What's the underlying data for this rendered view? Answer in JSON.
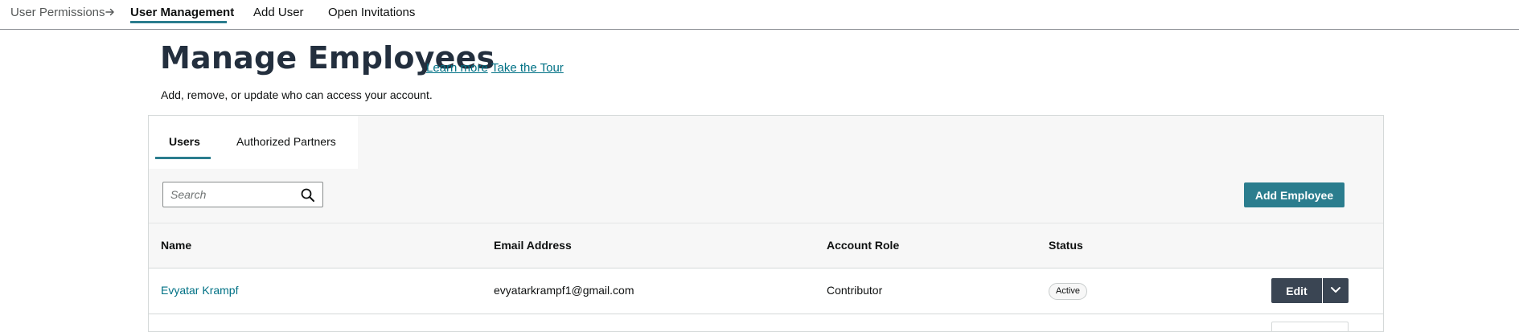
{
  "breadcrumb": {
    "parent": "User Permissions",
    "separator_icon": "arrow-right-icon"
  },
  "nav": {
    "items": [
      {
        "label": "User Management",
        "active": true
      },
      {
        "label": "Add User",
        "active": false
      },
      {
        "label": "Open Invitations",
        "active": false
      }
    ]
  },
  "header": {
    "title": "Manage Employees",
    "learn_more": "Learn more",
    "take_tour": "Take the Tour",
    "subtitle": "Add, remove, or update who can access your account."
  },
  "tabs": [
    {
      "label": "Users",
      "active": true
    },
    {
      "label": "Authorized Partners",
      "active": false
    }
  ],
  "toolbar": {
    "search_placeholder": "Search",
    "search_value": "",
    "search_icon": "search-icon",
    "add_employee_label": "Add Employee"
  },
  "table": {
    "columns": [
      "Name",
      "Email Address",
      "Account Role",
      "Status"
    ],
    "rows": [
      {
        "name": "Evyatar Krampf",
        "email": "evyatarkrampf1@gmail.com",
        "role": "Contributor",
        "status": "Active",
        "action_label": "Edit",
        "action_menu_icon": "chevron-down-icon"
      }
    ]
  },
  "colors": {
    "accent": "#2b7d8e",
    "link": "#007185",
    "dark_button": "#3a4553",
    "title": "#232f3e"
  }
}
